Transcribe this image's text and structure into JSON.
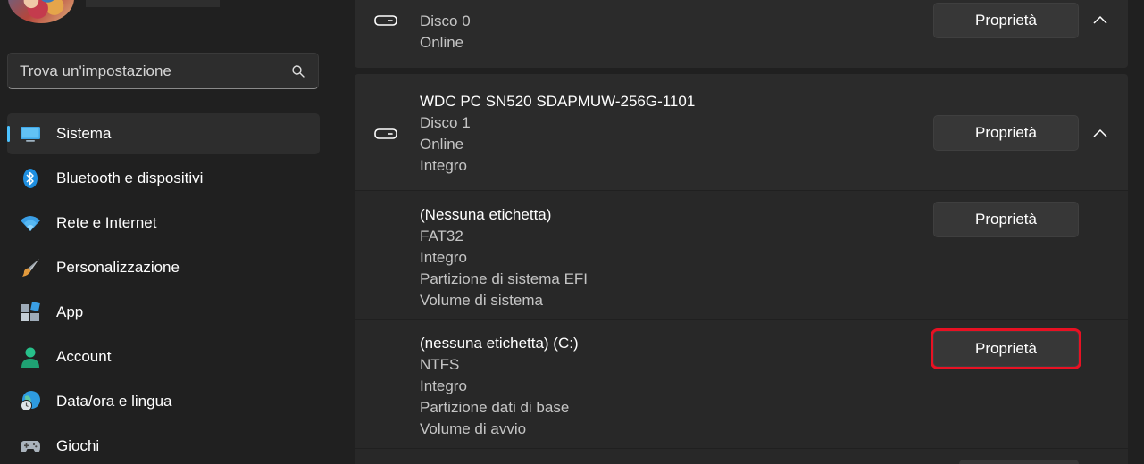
{
  "sidebar": {
    "search_placeholder": "Trova un'impostazione",
    "items": [
      {
        "label": "Sistema",
        "icon": "monitor-icon",
        "selected": true
      },
      {
        "label": "Bluetooth e dispositivi",
        "icon": "bluetooth-icon"
      },
      {
        "label": "Rete e Internet",
        "icon": "wifi-icon"
      },
      {
        "label": "Personalizzazione",
        "icon": "brush-icon"
      },
      {
        "label": "App",
        "icon": "apps-icon"
      },
      {
        "label": "Account",
        "icon": "person-icon"
      },
      {
        "label": "Data/ora e lingua",
        "icon": "globe-clock-icon"
      },
      {
        "label": "Giochi",
        "icon": "gamepad-icon"
      }
    ]
  },
  "disks": {
    "disk0": {
      "lines": [
        "Disco 0",
        "Online"
      ],
      "button": "Proprietà"
    },
    "disk1": {
      "name": "WDC PC SN520 SDAPMUW-256G-1101",
      "lines": [
        "Disco 1",
        "Online",
        "Integro"
      ],
      "button": "Proprietà"
    },
    "partitions": [
      {
        "label": "(Nessuna etichetta)",
        "lines": [
          "FAT32",
          "Integro",
          "Partizione di sistema EFI",
          "Volume di sistema"
        ],
        "button": "Proprietà"
      },
      {
        "label": "(nessuna etichetta) (C:)",
        "lines": [
          "NTFS",
          "Integro",
          "Partizione dati di base",
          "Volume di avvio"
        ],
        "button": "Proprietà",
        "highlighted": true
      }
    ]
  },
  "colors": {
    "accent": "#4cc2ff",
    "highlight": "#e81123",
    "background": "#202020",
    "card": "#2b2b2b"
  }
}
